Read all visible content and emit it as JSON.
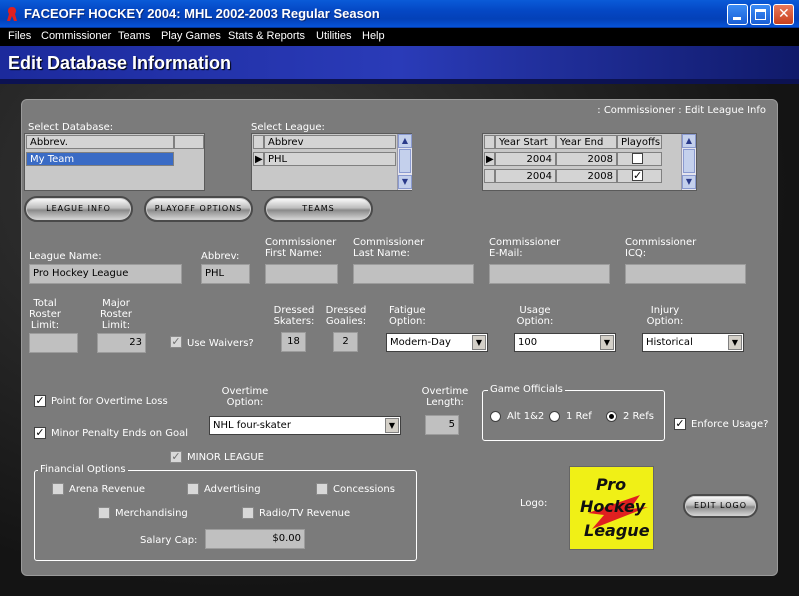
{
  "window": {
    "title": "FACEOFF HOCKEY 2004: MHL 2002-2003 Regular Season"
  },
  "menu": [
    "Files",
    "Commissioner",
    "Teams",
    "Play Games",
    "Stats & Reports",
    "Utilities",
    "Help"
  ],
  "header": {
    "title": "Edit Database Information",
    "breadcrumb": ": Commissioner : Edit League Info"
  },
  "database": {
    "label": "Select Database:",
    "column": "Abbrev.",
    "rows": [
      "My Team"
    ]
  },
  "league": {
    "label": "Select League:",
    "column": "Abbrev",
    "rows": [
      "PHL"
    ]
  },
  "seasons": {
    "columns": [
      "Year Start",
      "Year End",
      "Playoffs"
    ],
    "rows": [
      {
        "start": "2004",
        "end": "2008",
        "playoffs": ""
      },
      {
        "start": "2004",
        "end": "2008",
        "playoffs": "✓"
      }
    ]
  },
  "buttons": {
    "league_info": "LEAGUE INFO",
    "playoff_options": "PLAYOFF OPTIONS",
    "teams": "TEAMS",
    "edit_logo": "EDIT LOGO"
  },
  "info": {
    "league_name_label": "League Name:",
    "league_name": "Pro Hockey League",
    "abbrev_label": "Abbrev:",
    "abbrev": "PHL",
    "comm_first_label": "Commissioner First Name:",
    "comm_first": "",
    "comm_last_label": "Commissioner Last Name:",
    "comm_last": "",
    "comm_email_label": "Commissioner E-Mail:",
    "comm_email": "",
    "comm_icq_label": "Commissioner ICQ:",
    "comm_icq": ""
  },
  "roster": {
    "total_label": "Total Roster Limit:",
    "total": "",
    "major_label": "Major Roster Limit:",
    "major": "23",
    "waivers_label": "Use Waivers?",
    "waivers_checked": "✓",
    "skaters_label": "Dressed Skaters:",
    "skaters": "18",
    "goalies_label": "Dressed Goalies:",
    "goalies": "2",
    "fatigue_label": "Fatigue Option:",
    "fatigue": "Modern-Day",
    "usage_label": "Usage Option:",
    "usage": "100",
    "injury_label": "Injury Option:",
    "injury": "Historical"
  },
  "rules": {
    "otl_label": "Point for Overtime Loss",
    "otl_checked": "✓",
    "minor_penalty_label": "Minor Penalty Ends on Goal",
    "minor_penalty_checked": "✓",
    "ot_option_label": "Overtime Option:",
    "ot_option": "NHL four-skater",
    "ot_length_label": "Overtime Length:",
    "ot_length": "5",
    "officials_label": "Game Officials",
    "officials": [
      "Alt 1&2",
      "1 Ref",
      "2 Refs"
    ],
    "enforce_label": "Enforce Usage?",
    "enforce_checked": "✓",
    "minor_league_label": "MINOR LEAGUE",
    "minor_league_checked": "✓"
  },
  "financial": {
    "label": "Financial Options",
    "arena": "Arena Revenue",
    "advertising": "Advertising",
    "concessions": "Concessions",
    "merchandising": "Merchandising",
    "radio_tv": "Radio/TV Revenue",
    "salary_cap_label": "Salary Cap:",
    "salary_cap": "$0.00"
  },
  "logo": {
    "label": "Logo:",
    "line1": "Pro",
    "line2": "Hockey",
    "line3": "League"
  },
  "colors": {
    "titlebar": "#0447c4",
    "header": "#2a3bb8",
    "panel": "#7b7b7b",
    "logo_bg": "#f0f016",
    "logo_accent": "#e02020"
  }
}
